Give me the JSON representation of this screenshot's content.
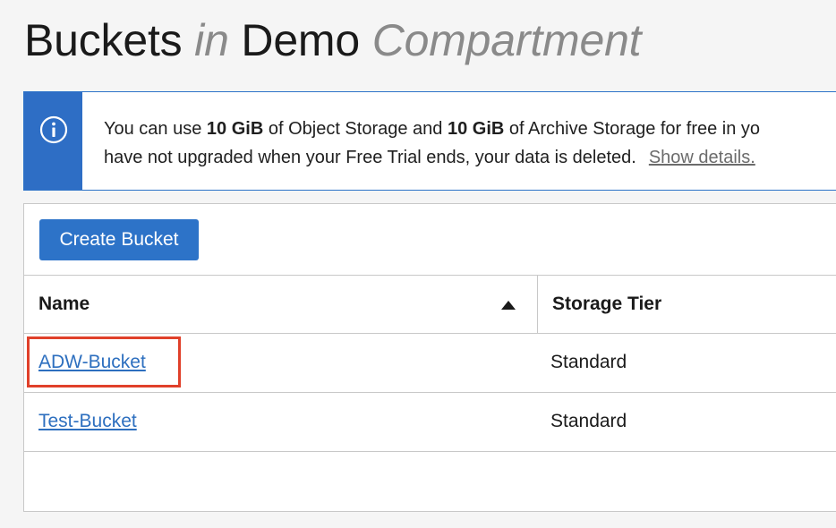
{
  "header": {
    "title_main": "Buckets",
    "title_in": "in",
    "title_compartment_name": "Demo",
    "title_compartment_word": "Compartment"
  },
  "banner": {
    "icon": "info-icon",
    "accent_color": "#2e6ec5",
    "line1_prefix": "You can use ",
    "line1_amount1": "10 GiB",
    "line1_mid": " of Object Storage and ",
    "line1_amount2": "10 GiB",
    "line1_suffix": " of Archive Storage for free in yo",
    "line2_text": "have not upgraded when your Free Trial ends, your data is deleted.",
    "line2_link": "Show details."
  },
  "toolbar": {
    "create_label": "Create Bucket",
    "button_color": "#2d73c8"
  },
  "table": {
    "columns": [
      {
        "label": "Name",
        "sort": "ascending",
        "sort_icon": "sort-ascending-icon"
      },
      {
        "label": "Storage Tier"
      }
    ],
    "rows": [
      {
        "name": "ADW-Bucket",
        "tier": "Standard",
        "highlighted": true
      },
      {
        "name": "Test-Bucket",
        "tier": "Standard",
        "highlighted": false
      }
    ]
  },
  "annotation": {
    "highlight_color": "#e0402a"
  }
}
